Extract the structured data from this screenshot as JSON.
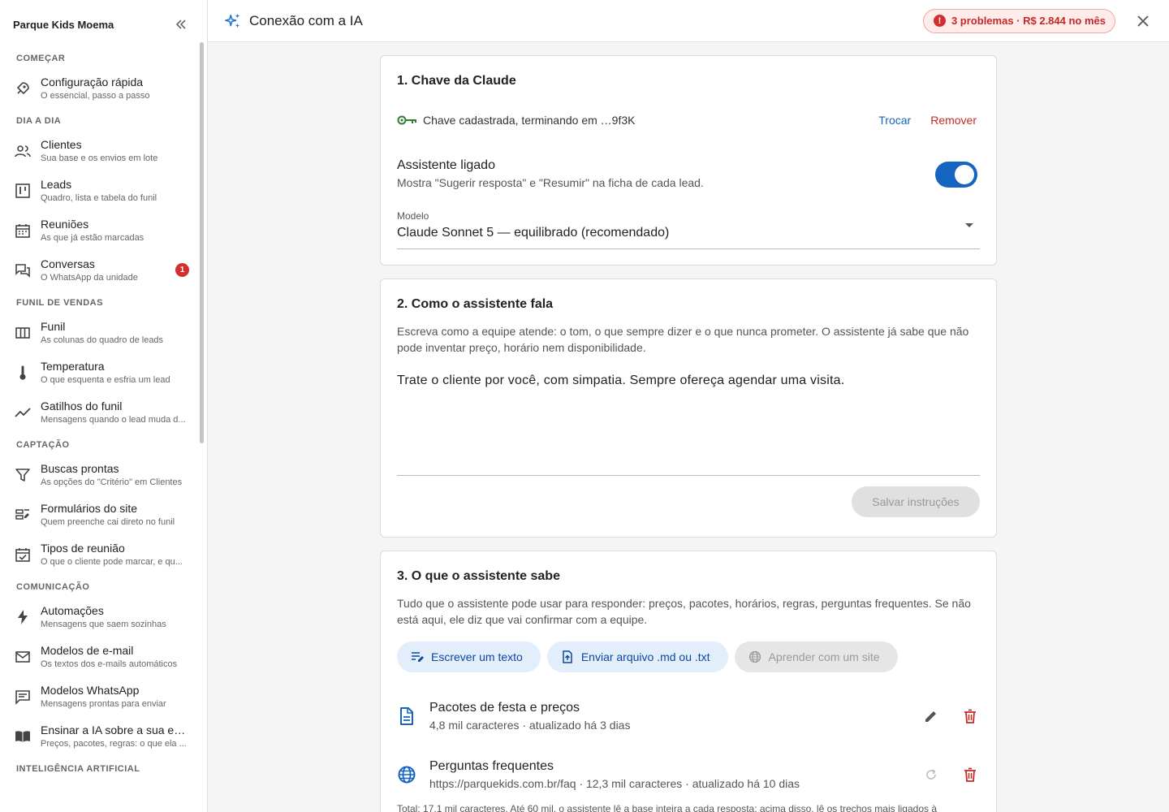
{
  "sidebar": {
    "title": "Parque Kids Moema",
    "sections": [
      {
        "label": "COMEÇAR",
        "items": [
          {
            "icon": "rocket-icon",
            "title": "Configuração rápida",
            "sub": "O essencial, passo a passo"
          }
        ]
      },
      {
        "label": "DIA A DIA",
        "items": [
          {
            "icon": "people-icon",
            "title": "Clientes",
            "sub": "Sua base e os envios em lote"
          },
          {
            "icon": "board-icon",
            "title": "Leads",
            "sub": "Quadro, lista e tabela do funil"
          },
          {
            "icon": "calendar-icon",
            "title": "Reuniões",
            "sub": "As que já estão marcadas"
          },
          {
            "icon": "chat-icon",
            "title": "Conversas",
            "sub": "O WhatsApp da unidade",
            "badge": "1"
          }
        ]
      },
      {
        "label": "FUNIL DE VENDAS",
        "items": [
          {
            "icon": "columns-icon",
            "title": "Funil",
            "sub": "As colunas do quadro de leads"
          },
          {
            "icon": "thermometer-icon",
            "title": "Temperatura",
            "sub": "O que esquenta e esfria um lead"
          },
          {
            "icon": "trend-icon",
            "title": "Gatilhos do funil",
            "sub": "Mensagens quando o lead muda d..."
          }
        ]
      },
      {
        "label": "CAPTAÇÃO",
        "items": [
          {
            "icon": "filter-icon",
            "title": "Buscas prontas",
            "sub": "As opções do \"Critério\" em Clientes"
          },
          {
            "icon": "form-icon",
            "title": "Formulários do site",
            "sub": "Quem preenche cai direto no funil"
          },
          {
            "icon": "event-icon",
            "title": "Tipos de reunião",
            "sub": "O que o cliente pode marcar, e qu..."
          }
        ]
      },
      {
        "label": "COMUNICAÇÃO",
        "items": [
          {
            "icon": "bolt-icon",
            "title": "Automações",
            "sub": "Mensagens que saem sozinhas"
          },
          {
            "icon": "mail-icon",
            "title": "Modelos de e-mail",
            "sub": "Os textos dos e-mails automáticos"
          },
          {
            "icon": "message-icon",
            "title": "Modelos WhatsApp",
            "sub": "Mensagens prontas para enviar"
          },
          {
            "icon": "book-icon",
            "title": "Ensinar a IA sobre a sua em...",
            "sub": "Preços, pacotes, regras: o que ela ..."
          }
        ]
      },
      {
        "label": "INTELIGÊNCIA ARTIFICIAL",
        "items": []
      }
    ]
  },
  "topbar": {
    "title": "Conexão com a IA",
    "problems": "3 problemas · R$ 2.844 no mês"
  },
  "card1": {
    "title": "1. Chave da Claude",
    "key_text": "Chave cadastrada, terminando em …9f3K",
    "swap": "Trocar",
    "remove": "Remover",
    "toggle_label": "Assistente ligado",
    "toggle_sub": "Mostra \"Sugerir resposta\" e \"Resumir\" na ficha de cada lead.",
    "toggle_on": true,
    "model_label": "Modelo",
    "model_value": "Claude Sonnet 5 — equilibrado (recomendado)"
  },
  "card2": {
    "title": "2. Como o assistente fala",
    "desc": "Escreva como a equipe atende: o tom, o que sempre dizer e o que nunca prometer. O assistente já sabe que não pode inventar preço, horário nem disponibilidade.",
    "instructions": "Trate o cliente por você, com simpatia. Sempre ofereça agendar uma visita.",
    "save": "Salvar instruções"
  },
  "card3": {
    "title": "3. O que o assistente sabe",
    "desc": "Tudo que o assistente pode usar para responder: preços, pacotes, horários, regras, perguntas frequentes. Se não está aqui, ele diz que vai confirmar com a equipe.",
    "chips": {
      "write": "Escrever um texto",
      "upload": "Enviar arquivo .md ou .txt",
      "site": "Aprender com um site"
    },
    "docs": [
      {
        "icon": "document-icon",
        "title": "Pacotes de festa e preços",
        "meta": "4,8 mil caracteres · atualizado há 3 dias"
      },
      {
        "icon": "globe-icon",
        "title": "Perguntas frequentes",
        "meta": "https://parquekids.com.br/faq · 12,3 mil caracteres · atualizado há 10 dias"
      }
    ],
    "footnote": "Total: 17,1 mil caracteres. Até 60 mil, o assistente lê a base inteira a cada resposta; acima disso, lê os trechos mais ligados à"
  },
  "colors": {
    "primary": "#1565c0",
    "danger": "#c62828",
    "key_green": "#2e7d32"
  }
}
